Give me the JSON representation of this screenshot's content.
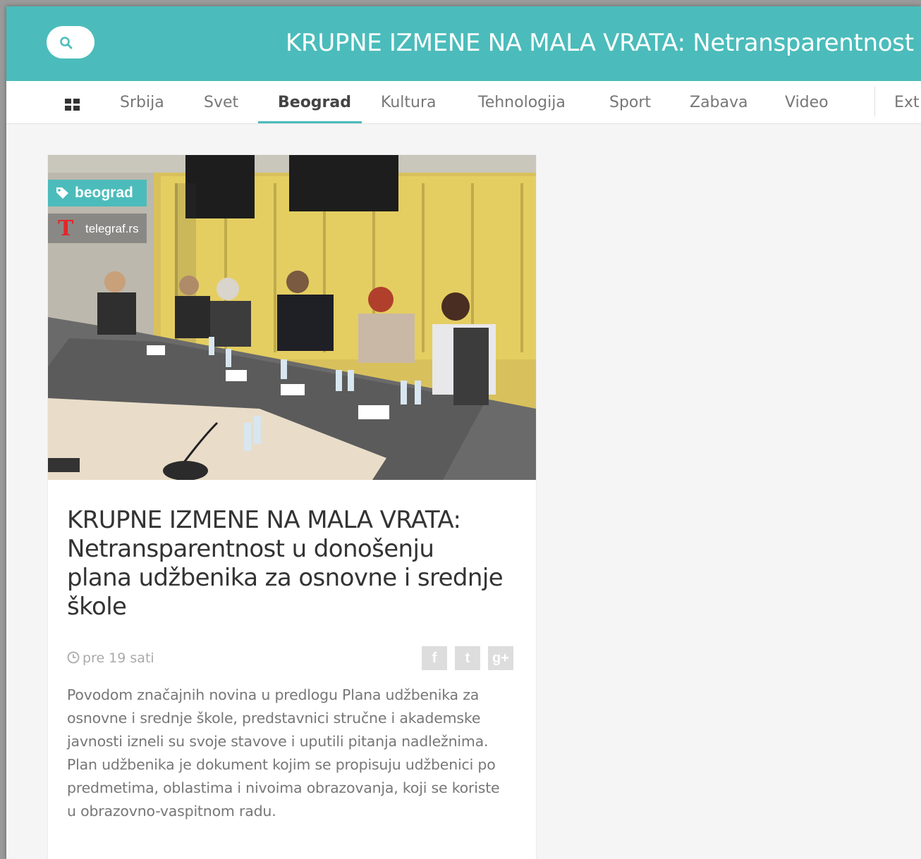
{
  "header": {
    "title": "KRUPNE IZMENE NA MALA VRATA: Netransparentnost"
  },
  "nav": {
    "items": [
      {
        "label": "Srbija"
      },
      {
        "label": "Svet"
      },
      {
        "label": "Beograd"
      },
      {
        "label": "Kultura"
      },
      {
        "label": "Tehnologija"
      },
      {
        "label": "Sport"
      },
      {
        "label": "Zabava"
      },
      {
        "label": "Video"
      },
      {
        "label": "Ext"
      }
    ],
    "active": "Beograd"
  },
  "article": {
    "tag": "beograd",
    "source": "telegraf.rs",
    "source_logo": "T",
    "title": "KRUPNE IZMENE NA MALA VRATA: Netransparentnost u donošenju plana udžbenika za osnovne i srednje škole",
    "time": "pre 19 sati",
    "share": {
      "facebook": "f",
      "twitter": "t",
      "googleplus": "g+"
    },
    "excerpt": "Povodom značajnih novina u predlogu Plana udžbenika za osnovne i srednje škole, predstavnici stručne i akademske javnosti izneli su svoje stavove i uputili pitanja nadležnima. Plan udžbenika je dokument kojim se propisuju udžbenici po predmetima, oblastima i nivoima obrazovanja, koji se koriste u obrazovno-vaspitnom radu."
  },
  "colors": {
    "accent": "#4bbcbb",
    "source_logo": "#e3262b"
  }
}
